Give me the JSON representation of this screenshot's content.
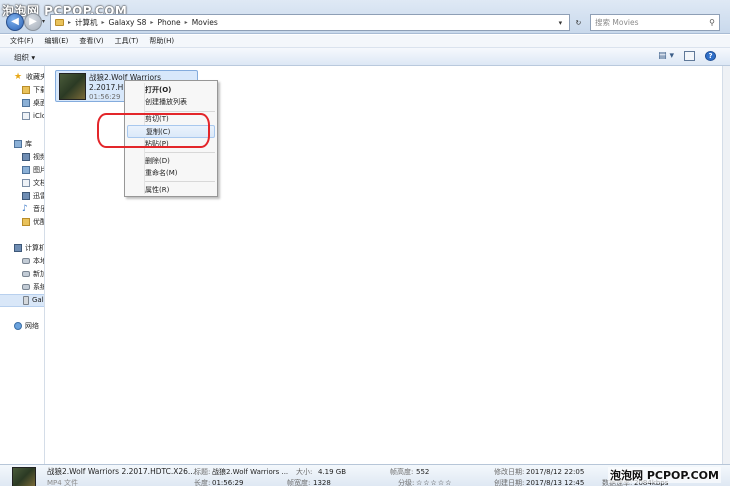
{
  "watermark_top": "泡泡网 PCPOP.COM",
  "watermark_bottom": "泡泡网 PCPOP.COM",
  "address": {
    "crumbs": [
      "计算机",
      "Galaxy S8",
      "Phone",
      "Movies"
    ],
    "search_placeholder": "搜索 Movies"
  },
  "menubar": [
    "文件(F)",
    "编辑(E)",
    "查看(V)",
    "工具(T)",
    "帮助(H)"
  ],
  "toolbar": {
    "organize": "组织 ▾"
  },
  "navpane": {
    "favorites": "收藏夹",
    "downloads": "下载",
    "desktop": "桌面",
    "icloud": "iClo",
    "libraries": "库",
    "videos": "视频",
    "pictures": "图片",
    "documents": "文档",
    "thunder": "迅雷",
    "music": "音乐",
    "youku": "优酷",
    "computer": "计算机",
    "local_disk": "本地",
    "new_volume": "新加",
    "system": "系统",
    "galaxy": "Gala",
    "network": "网络"
  },
  "file": {
    "name_line1": "战狼2.Wolf Warriors",
    "name_line2": "2.2017.HDTC.X264",
    "duration": "01:56:29"
  },
  "context_menu": {
    "open": "打开(O)",
    "create_playlist": "创建播放列表",
    "cut": "剪切(T)",
    "copy": "复制(C)",
    "paste": "粘贴(P)",
    "delete": "删除(D)",
    "rename": "重命名(M)",
    "properties": "属性(R)"
  },
  "details": {
    "name": "战狼2.Wolf Warriors 2.2017.HDTC.X26...",
    "type": "MP4 文件",
    "title_label": "标题:",
    "title_value": "战狼2.Wolf Warriors ...",
    "length_label": "长度:",
    "length_value": "01:56:29",
    "size_label": "大小:",
    "size_value": "4.19 GB",
    "width_label": "帧宽度:",
    "width_value": "1328",
    "height_label": "帧高度:",
    "height_value": "552",
    "rating_label": "分级:",
    "rating_stars": "☆☆☆☆☆",
    "modified_label": "修改日期:",
    "modified_value": "2017/8/12 22:05",
    "created_label": "创建日期:",
    "created_value": "2017/8/13 12:45",
    "data_rate_label": "数据速率:",
    "data_rate_value": "2084kbps"
  }
}
